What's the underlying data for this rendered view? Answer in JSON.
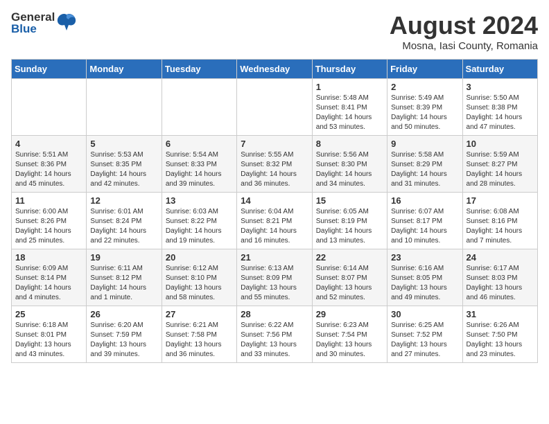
{
  "header": {
    "logo_general": "General",
    "logo_blue": "Blue",
    "month_year": "August 2024",
    "location": "Mosna, Iasi County, Romania"
  },
  "weekdays": [
    "Sunday",
    "Monday",
    "Tuesday",
    "Wednesday",
    "Thursday",
    "Friday",
    "Saturday"
  ],
  "weeks": [
    [
      {
        "day": "",
        "info": ""
      },
      {
        "day": "",
        "info": ""
      },
      {
        "day": "",
        "info": ""
      },
      {
        "day": "",
        "info": ""
      },
      {
        "day": "1",
        "info": "Sunrise: 5:48 AM\nSunset: 8:41 PM\nDaylight: 14 hours\nand 53 minutes."
      },
      {
        "day": "2",
        "info": "Sunrise: 5:49 AM\nSunset: 8:39 PM\nDaylight: 14 hours\nand 50 minutes."
      },
      {
        "day": "3",
        "info": "Sunrise: 5:50 AM\nSunset: 8:38 PM\nDaylight: 14 hours\nand 47 minutes."
      }
    ],
    [
      {
        "day": "4",
        "info": "Sunrise: 5:51 AM\nSunset: 8:36 PM\nDaylight: 14 hours\nand 45 minutes."
      },
      {
        "day": "5",
        "info": "Sunrise: 5:53 AM\nSunset: 8:35 PM\nDaylight: 14 hours\nand 42 minutes."
      },
      {
        "day": "6",
        "info": "Sunrise: 5:54 AM\nSunset: 8:33 PM\nDaylight: 14 hours\nand 39 minutes."
      },
      {
        "day": "7",
        "info": "Sunrise: 5:55 AM\nSunset: 8:32 PM\nDaylight: 14 hours\nand 36 minutes."
      },
      {
        "day": "8",
        "info": "Sunrise: 5:56 AM\nSunset: 8:30 PM\nDaylight: 14 hours\nand 34 minutes."
      },
      {
        "day": "9",
        "info": "Sunrise: 5:58 AM\nSunset: 8:29 PM\nDaylight: 14 hours\nand 31 minutes."
      },
      {
        "day": "10",
        "info": "Sunrise: 5:59 AM\nSunset: 8:27 PM\nDaylight: 14 hours\nand 28 minutes."
      }
    ],
    [
      {
        "day": "11",
        "info": "Sunrise: 6:00 AM\nSunset: 8:26 PM\nDaylight: 14 hours\nand 25 minutes."
      },
      {
        "day": "12",
        "info": "Sunrise: 6:01 AM\nSunset: 8:24 PM\nDaylight: 14 hours\nand 22 minutes."
      },
      {
        "day": "13",
        "info": "Sunrise: 6:03 AM\nSunset: 8:22 PM\nDaylight: 14 hours\nand 19 minutes."
      },
      {
        "day": "14",
        "info": "Sunrise: 6:04 AM\nSunset: 8:21 PM\nDaylight: 14 hours\nand 16 minutes."
      },
      {
        "day": "15",
        "info": "Sunrise: 6:05 AM\nSunset: 8:19 PM\nDaylight: 14 hours\nand 13 minutes."
      },
      {
        "day": "16",
        "info": "Sunrise: 6:07 AM\nSunset: 8:17 PM\nDaylight: 14 hours\nand 10 minutes."
      },
      {
        "day": "17",
        "info": "Sunrise: 6:08 AM\nSunset: 8:16 PM\nDaylight: 14 hours\nand 7 minutes."
      }
    ],
    [
      {
        "day": "18",
        "info": "Sunrise: 6:09 AM\nSunset: 8:14 PM\nDaylight: 14 hours\nand 4 minutes."
      },
      {
        "day": "19",
        "info": "Sunrise: 6:11 AM\nSunset: 8:12 PM\nDaylight: 14 hours\nand 1 minute."
      },
      {
        "day": "20",
        "info": "Sunrise: 6:12 AM\nSunset: 8:10 PM\nDaylight: 13 hours\nand 58 minutes."
      },
      {
        "day": "21",
        "info": "Sunrise: 6:13 AM\nSunset: 8:09 PM\nDaylight: 13 hours\nand 55 minutes."
      },
      {
        "day": "22",
        "info": "Sunrise: 6:14 AM\nSunset: 8:07 PM\nDaylight: 13 hours\nand 52 minutes."
      },
      {
        "day": "23",
        "info": "Sunrise: 6:16 AM\nSunset: 8:05 PM\nDaylight: 13 hours\nand 49 minutes."
      },
      {
        "day": "24",
        "info": "Sunrise: 6:17 AM\nSunset: 8:03 PM\nDaylight: 13 hours\nand 46 minutes."
      }
    ],
    [
      {
        "day": "25",
        "info": "Sunrise: 6:18 AM\nSunset: 8:01 PM\nDaylight: 13 hours\nand 43 minutes."
      },
      {
        "day": "26",
        "info": "Sunrise: 6:20 AM\nSunset: 7:59 PM\nDaylight: 13 hours\nand 39 minutes."
      },
      {
        "day": "27",
        "info": "Sunrise: 6:21 AM\nSunset: 7:58 PM\nDaylight: 13 hours\nand 36 minutes."
      },
      {
        "day": "28",
        "info": "Sunrise: 6:22 AM\nSunset: 7:56 PM\nDaylight: 13 hours\nand 33 minutes."
      },
      {
        "day": "29",
        "info": "Sunrise: 6:23 AM\nSunset: 7:54 PM\nDaylight: 13 hours\nand 30 minutes."
      },
      {
        "day": "30",
        "info": "Sunrise: 6:25 AM\nSunset: 7:52 PM\nDaylight: 13 hours\nand 27 minutes."
      },
      {
        "day": "31",
        "info": "Sunrise: 6:26 AM\nSunset: 7:50 PM\nDaylight: 13 hours\nand 23 minutes."
      }
    ]
  ]
}
